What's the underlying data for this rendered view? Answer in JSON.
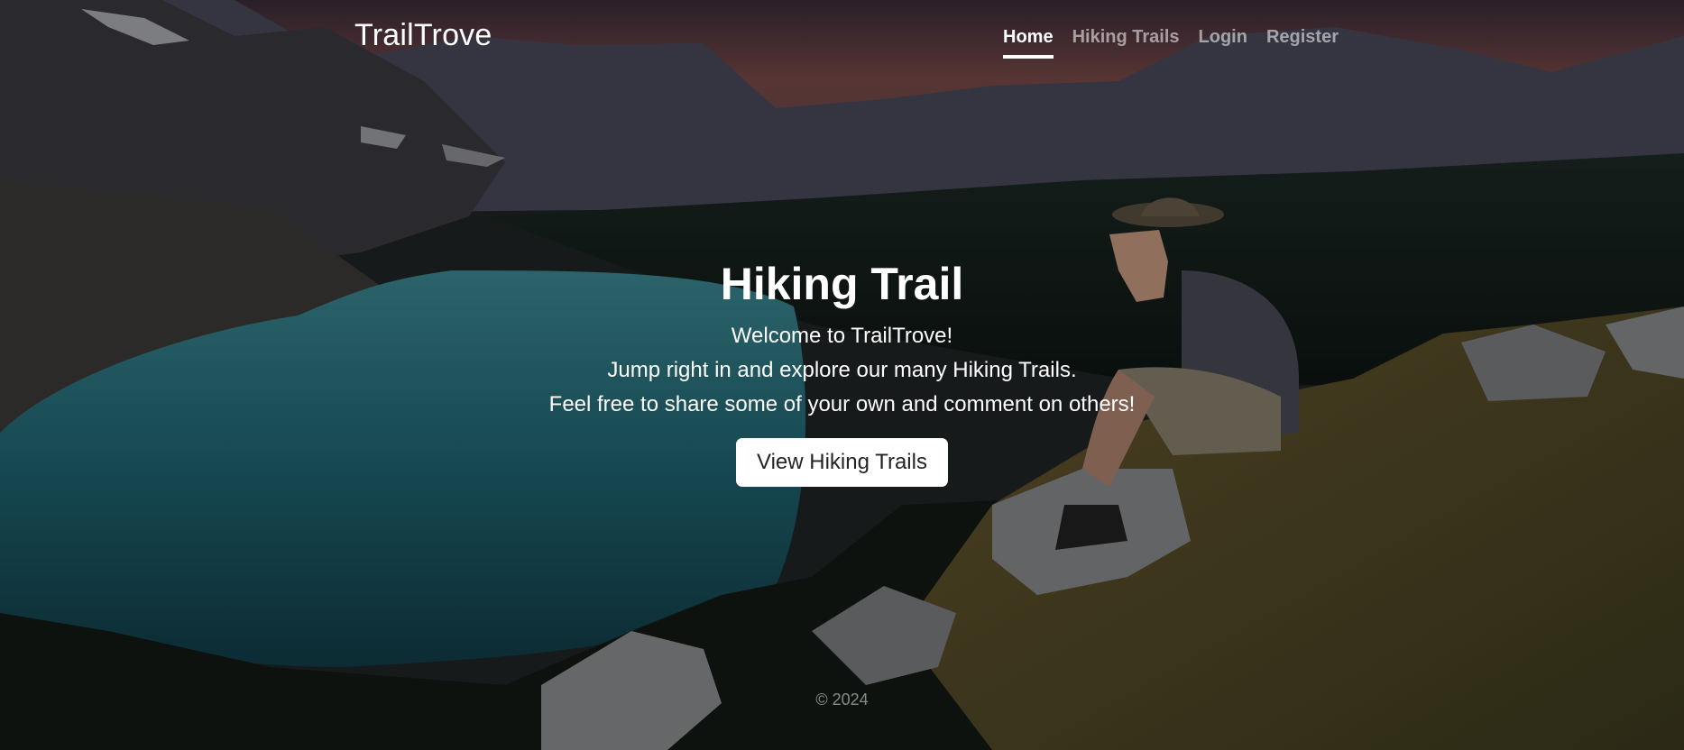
{
  "header": {
    "brand": "TrailTrove",
    "nav": [
      {
        "label": "Home",
        "active": true
      },
      {
        "label": "Hiking Trails",
        "active": false
      },
      {
        "label": "Login",
        "active": false
      },
      {
        "label": "Register",
        "active": false
      }
    ]
  },
  "main": {
    "title": "Hiking Trail",
    "lead": [
      "Welcome to TrailTrove!",
      "Jump right in and explore our many Hiking Trails.",
      "Feel free to share some of your own and comment on others!"
    ],
    "button_label": "View Hiking Trails"
  },
  "footer": {
    "copyright": "© 2024"
  },
  "colors": {
    "text": "#ffffff",
    "nav_inactive": "rgba(255,255,255,0.55)",
    "button_bg": "#ffffff",
    "button_text": "#212529"
  }
}
